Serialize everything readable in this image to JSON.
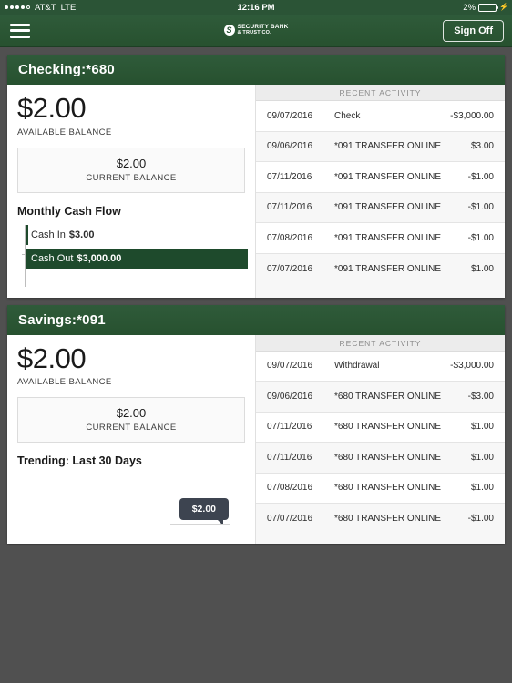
{
  "status_bar": {
    "carrier": "AT&T",
    "network": "LTE",
    "time": "12:16 PM",
    "battery_percent": "2%",
    "signal_dots_filled": 4,
    "signal_dots_total": 5,
    "charging_icon": "lightning-bolt-icon"
  },
  "header": {
    "menu_icon": "hamburger-menu-icon",
    "logo_mark": "security-bank-s-emblem-icon",
    "logo_line1": "SECURITY BANK",
    "logo_line2": "& TRUST CO.",
    "sign_off_label": "Sign Off"
  },
  "theme": {
    "brand_green": "#2b5436",
    "header_green": "#2f5b3a",
    "bar_green": "#1e4a2c",
    "tooltip_slate": "#3d4450",
    "page_background": "#505050"
  },
  "accounts": [
    {
      "title": "Checking:*680",
      "available_balance": "$2.00",
      "available_label": "AVAILABLE BALANCE",
      "current_balance": "$2.00",
      "current_label": "CURRENT BALANCE",
      "chart_section_title": "Monthly Cash Flow",
      "chart_kind": "cashflow",
      "activity_header": "RECENT ACTIVITY",
      "activity": [
        {
          "date": "09/07/2016",
          "description": "Check",
          "amount": "-$3,000.00"
        },
        {
          "date": "09/06/2016",
          "description": "*091 TRANSFER ONLINE",
          "amount": "$3.00"
        },
        {
          "date": "07/11/2016",
          "description": "*091 TRANSFER ONLINE",
          "amount": "-$1.00"
        },
        {
          "date": "07/11/2016",
          "description": "*091 TRANSFER ONLINE",
          "amount": "-$1.00"
        },
        {
          "date": "07/08/2016",
          "description": "*091 TRANSFER ONLINE",
          "amount": "-$1.00"
        },
        {
          "date": "07/07/2016",
          "description": "*091 TRANSFER ONLINE",
          "amount": "$1.00"
        }
      ]
    },
    {
      "title": "Savings:*091",
      "available_balance": "$2.00",
      "available_label": "AVAILABLE BALANCE",
      "current_balance": "$2.00",
      "current_label": "CURRENT BALANCE",
      "chart_section_title": "Trending: Last 30 Days",
      "chart_kind": "trending",
      "tooltip_value": "$2.00",
      "activity_header": "RECENT ACTIVITY",
      "activity": [
        {
          "date": "09/07/2016",
          "description": "Withdrawal",
          "amount": "-$3,000.00"
        },
        {
          "date": "09/06/2016",
          "description": "*680 TRANSFER ONLINE",
          "amount": "-$3.00"
        },
        {
          "date": "07/11/2016",
          "description": "*680 TRANSFER ONLINE",
          "amount": "$1.00"
        },
        {
          "date": "07/11/2016",
          "description": "*680 TRANSFER ONLINE",
          "amount": "$1.00"
        },
        {
          "date": "07/08/2016",
          "description": "*680 TRANSFER ONLINE",
          "amount": "$1.00"
        },
        {
          "date": "07/07/2016",
          "description": "*680 TRANSFER ONLINE",
          "amount": "-$1.00"
        }
      ]
    }
  ],
  "chart_data": [
    {
      "type": "bar",
      "title": "Monthly Cash Flow",
      "orientation": "horizontal",
      "categories": [
        "Cash In",
        "Cash Out"
      ],
      "values": [
        3.0,
        3000.0
      ],
      "value_labels": [
        "$3.00",
        "$3,000.00"
      ],
      "xlabel": "",
      "ylabel": "",
      "xlim": [
        0,
        3000
      ],
      "grid": false,
      "legend": "none",
      "series_color": "#1e4a2c"
    },
    {
      "type": "line",
      "title": "Trending: Last 30 Days",
      "annotations": [
        "$2.00"
      ],
      "values": [
        2.0
      ],
      "xlabel": "",
      "ylabel": "",
      "grid": false,
      "legend": "none",
      "line_color": "#d5d5d5"
    }
  ]
}
